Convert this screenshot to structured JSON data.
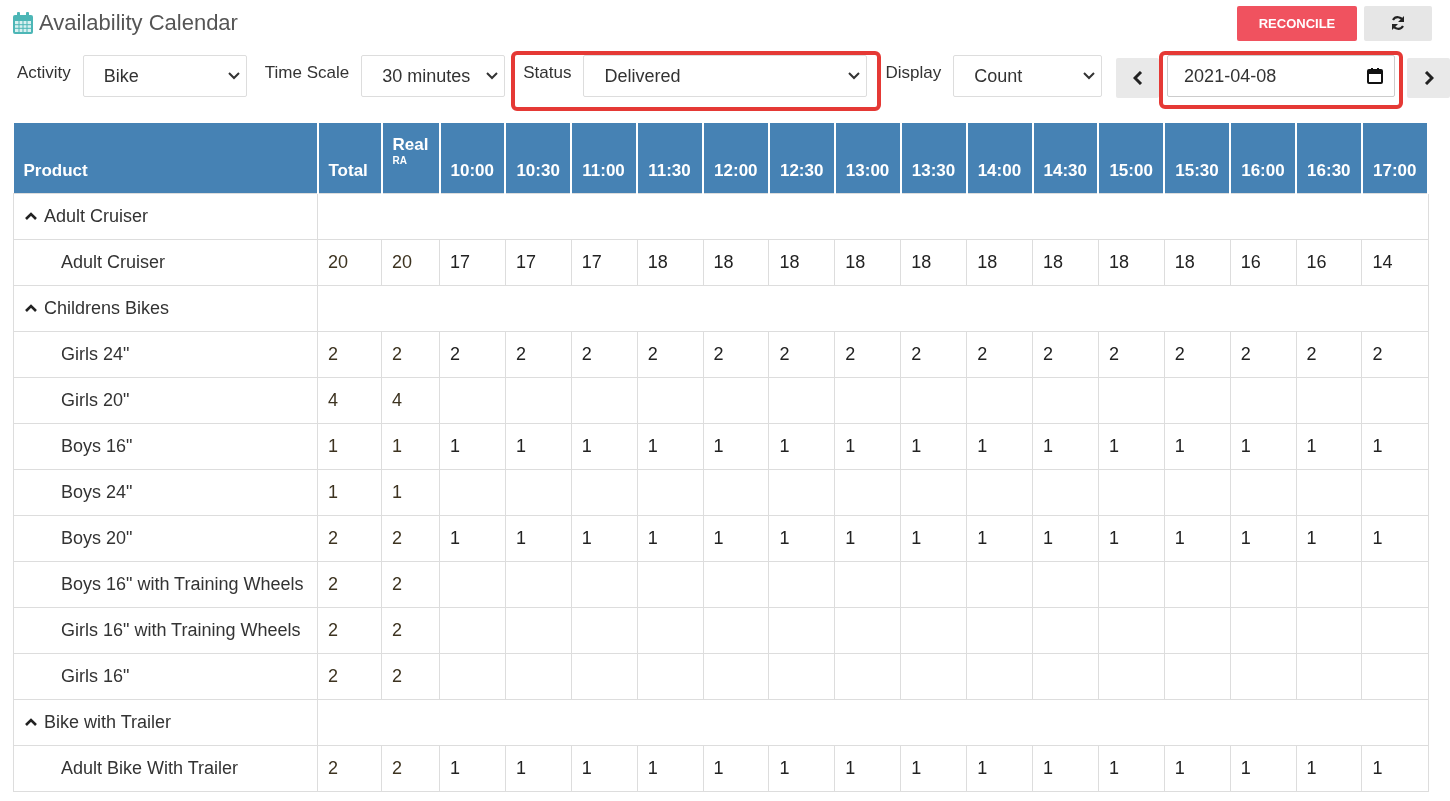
{
  "header": {
    "title": "Availability Calendar",
    "reconcile_button": "RECONCILE"
  },
  "filters": [
    {
      "label": "Activity",
      "value": "Bike",
      "highlighted": false
    },
    {
      "label": "Time Scale",
      "value": "30 minutes",
      "highlighted": false
    },
    {
      "label": "Status",
      "value": "Delivered",
      "highlighted": true
    },
    {
      "label": "Display",
      "value": "Count",
      "highlighted": false
    }
  ],
  "date_picker": {
    "value": "2021-04-08",
    "highlighted": true
  },
  "table": {
    "columns": [
      {
        "label": "Product"
      },
      {
        "label": "Total"
      },
      {
        "label": "Real",
        "sub": "RA"
      },
      {
        "label": "10:00"
      },
      {
        "label": "10:30"
      },
      {
        "label": "11:00"
      },
      {
        "label": "11:30"
      },
      {
        "label": "12:00"
      },
      {
        "label": "12:30"
      },
      {
        "label": "13:00"
      },
      {
        "label": "13:30"
      },
      {
        "label": "14:00"
      },
      {
        "label": "14:30"
      },
      {
        "label": "15:00"
      },
      {
        "label": "15:30"
      },
      {
        "label": "16:00"
      },
      {
        "label": "16:30"
      },
      {
        "label": "17:00"
      }
    ],
    "groups": [
      {
        "name": "Adult Cruiser",
        "expanded": true,
        "children": [
          {
            "name": "Adult Cruiser",
            "total": "20",
            "real": "20",
            "values": [
              "17",
              "17",
              "17",
              "18",
              "18",
              "18",
              "18",
              "18",
              "18",
              "18",
              "18",
              "18",
              "16",
              "16",
              "14"
            ]
          }
        ]
      },
      {
        "name": "Childrens Bikes",
        "expanded": true,
        "children": [
          {
            "name": "Girls 24\"",
            "total": "2",
            "real": "2",
            "values": [
              "2",
              "2",
              "2",
              "2",
              "2",
              "2",
              "2",
              "2",
              "2",
              "2",
              "2",
              "2",
              "2",
              "2",
              "2"
            ]
          },
          {
            "name": "Girls 20\"",
            "total": "4",
            "real": "4"
          },
          {
            "name": "Boys 16\"",
            "total": "1",
            "real": "1",
            "values": [
              "1",
              "1",
              "1",
              "1",
              "1",
              "1",
              "1",
              "1",
              "1",
              "1",
              "1",
              "1",
              "1",
              "1",
              "1"
            ]
          },
          {
            "name": "Boys 24\"",
            "total": "1",
            "real": "1"
          },
          {
            "name": "Boys 20\"",
            "total": "2",
            "real": "2",
            "values": [
              "1",
              "1",
              "1",
              "1",
              "1",
              "1",
              "1",
              "1",
              "1",
              "1",
              "1",
              "1",
              "1",
              "1",
              "1"
            ]
          },
          {
            "name": "Boys 16\" with Training Wheels",
            "total": "2",
            "real": "2"
          },
          {
            "name": "Girls 16\" with Training Wheels",
            "total": "2",
            "real": "2"
          },
          {
            "name": "Girls 16\"",
            "total": "2",
            "real": "2"
          }
        ]
      },
      {
        "name": "Bike with Trailer",
        "expanded": true,
        "children": [
          {
            "name": "Adult Bike With Trailer",
            "total": "2",
            "real": "2",
            "values": [
              "1",
              "1",
              "1",
              "1",
              "1",
              "1",
              "1",
              "1",
              "1",
              "1",
              "1",
              "1",
              "1",
              "1",
              "1"
            ]
          }
        ]
      }
    ]
  }
}
